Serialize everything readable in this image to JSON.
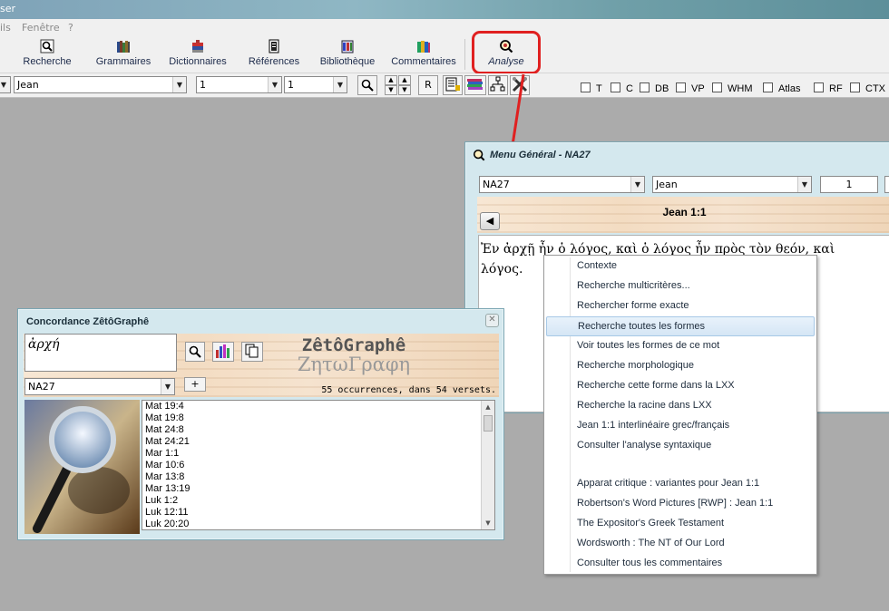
{
  "app": {
    "title_fragment": "ser"
  },
  "menubar": {
    "items": [
      "ils",
      "Fenêtre",
      "?"
    ]
  },
  "toolbar": {
    "buttons": [
      {
        "label": "Recherche",
        "icon": "search-icon"
      },
      {
        "label": "Grammaires",
        "icon": "books-icon"
      },
      {
        "label": "Dictionnaires",
        "icon": "dictionary-icon"
      },
      {
        "label": "Références",
        "icon": "references-icon"
      },
      {
        "label": "Bibliothèque",
        "icon": "library-icon"
      },
      {
        "label": "Commentaires",
        "icon": "commentaries-icon"
      },
      {
        "label": "Analyse",
        "icon": "analysis-icon"
      }
    ],
    "highlight_color": "#e02020"
  },
  "selector_bar": {
    "book": "Jean",
    "chapter": "1",
    "verse": "1",
    "r_label": "R",
    "checkboxes": [
      "T",
      "C",
      "DB",
      "VP",
      "WHM",
      "Atlas",
      "RF",
      "CTX"
    ]
  },
  "menu_window": {
    "title": "Menu Général - NA27",
    "version": "NA27",
    "book": "Jean",
    "chapter": "1",
    "reference": "Jean 1:1",
    "text_line1": "Ἐν ἀρχῇ ἦν ὁ λόγος, καὶ ὁ λόγος ἦν πρὸς τὸν θεόν, καὶ",
    "text_line2": "λόγος."
  },
  "concordance": {
    "title": "Concordance ZêtôGraphê",
    "query": "ἀρχή",
    "version": "NA27",
    "plus_label": "+",
    "brand_latin": "ZêtôGraphê",
    "brand_greek": "ΖητωΓραφη",
    "summary": "55 occurrences, dans 54 versets.",
    "results": [
      "Mat 19:4",
      "Mat 19:8",
      "Mat 24:8",
      "Mat 24:21",
      "Mar 1:1",
      "Mar 10:6",
      "Mar 13:8",
      "Mar 13:19",
      "Luk 1:2",
      "Luk 12:11",
      "Luk 20:20"
    ]
  },
  "context_menu": {
    "items": [
      "Contexte",
      "Recherche multicritères...",
      "Rechercher forme exacte",
      "Recherche toutes les formes",
      "Voir toutes les formes de ce mot",
      "Recherche morphologique",
      "Recherche cette forme dans la LXX",
      "Recherche la racine dans LXX",
      "Jean 1:1 interlinéaire grec/français",
      "Consulter l'analyse syntaxique",
      "",
      "Apparat critique : variantes pour Jean 1:1",
      "Robertson's Word Pictures [RWP] : Jean 1:1",
      "The Expositor's Greek Testament",
      "Wordsworth : The NT of Our Lord",
      "Consulter tous les commentaires"
    ],
    "highlighted_index": 3,
    "highlight_color": "#d5e6f5"
  }
}
